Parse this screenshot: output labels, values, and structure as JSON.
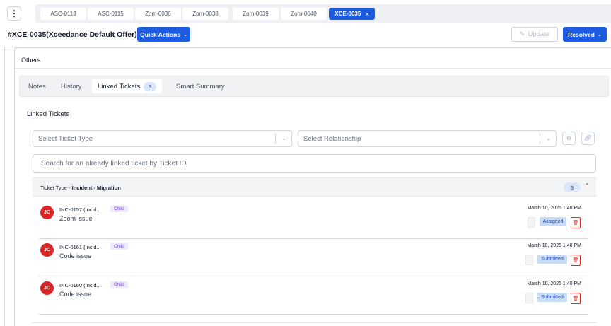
{
  "tabs": [
    {
      "label": "ASC-0113",
      "active": false
    },
    {
      "label": "ASC-0115",
      "active": false
    },
    {
      "label": "Zom-0036",
      "active": false
    },
    {
      "label": "Zom-0038",
      "active": false
    },
    {
      "label": "Zom-0039",
      "active": false
    },
    {
      "label": "Zom-0040",
      "active": false
    },
    {
      "label": "XCE-0035",
      "active": true,
      "close": "×"
    }
  ],
  "kebab_icon": "more-vertical-icon",
  "header": {
    "title": "#XCE-0035(Xceedance Default Offer)",
    "quick_actions": "Quick Actions",
    "update": "Update",
    "status": "Resolved"
  },
  "section": {
    "title": "Others"
  },
  "subtabs": [
    {
      "label": "Notes"
    },
    {
      "label": "History"
    },
    {
      "label": "Linked Tickets",
      "count": "3",
      "active": true
    },
    {
      "label": "Smart Summary"
    }
  ],
  "linked": {
    "heading": "Linked Tickets",
    "ticket_type_placeholder": "Select Ticket Type",
    "relationship_placeholder": "Select Relationship",
    "search_placeholder": "Search for an already linked ticket by Ticket ID",
    "group": {
      "prefix": "Ticket Type - ",
      "name": "Incident - Migration",
      "count": "3"
    },
    "rows": [
      {
        "initials": "JC",
        "id": "INC-0157 (Incid...",
        "relation": "Child",
        "title": "Zoom issue",
        "date": "March 10, 2025 1:40 PM",
        "status": "Assigned"
      },
      {
        "initials": "JC",
        "id": "INC-0161 (Incid...",
        "relation": "Child",
        "title": "Code issue",
        "date": "March 10, 2025 1:40 PM",
        "status": "Submitted"
      },
      {
        "initials": "JC",
        "id": "INC-0160 (Incid...",
        "relation": "Child",
        "title": "Code issue",
        "date": "March 10, 2025 1:40 PM",
        "status": "Submitted"
      }
    ]
  },
  "colors": {
    "primary": "#1d5be0",
    "avatar": "#dc2626",
    "status_bg": "#c7dbf7",
    "child_badge": "#7c3aed"
  }
}
